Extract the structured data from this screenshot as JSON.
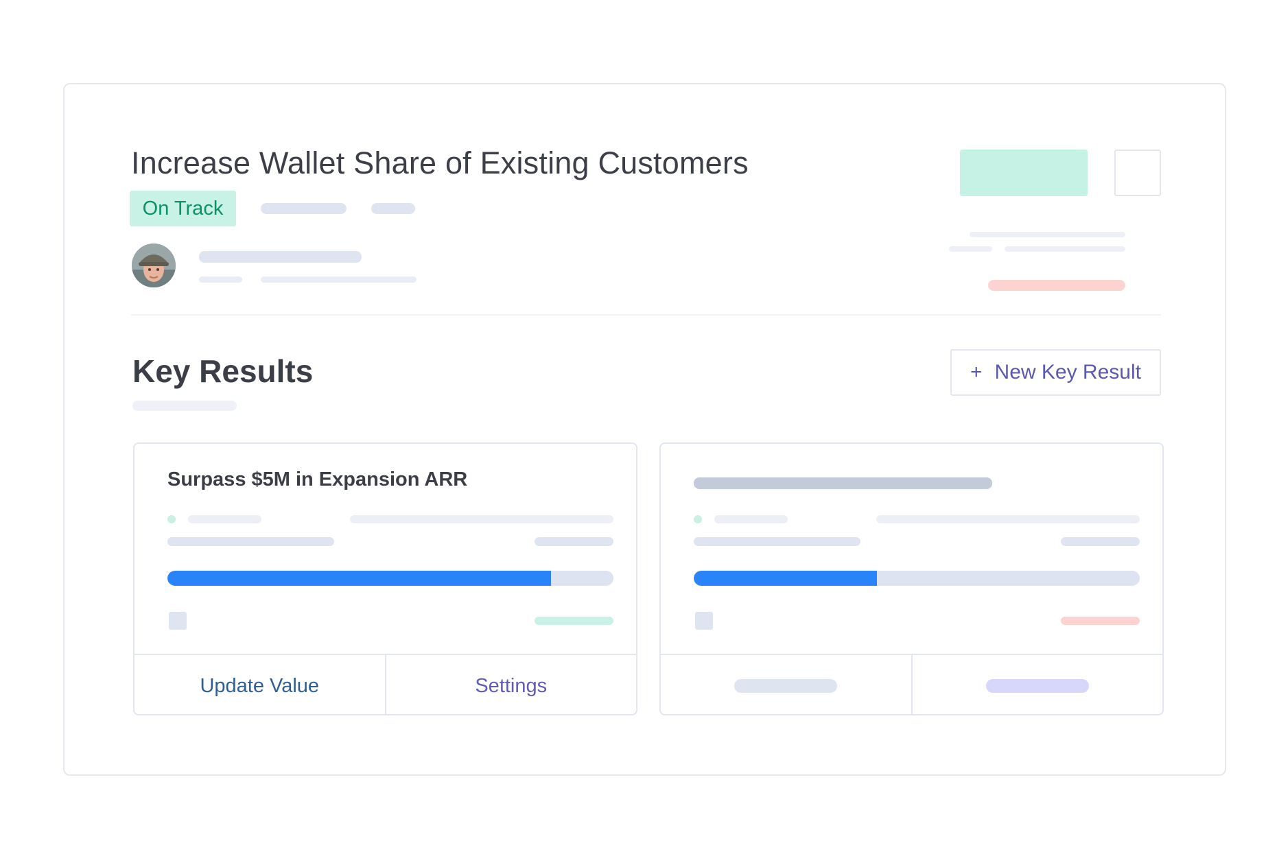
{
  "objective": {
    "title": "Increase Wallet Share of Existing Customers",
    "status": "On Track"
  },
  "key_results_section": {
    "title": "Key Results",
    "new_button_label": "New Key Result",
    "new_button_icon": "plus-icon"
  },
  "cards": [
    {
      "title": "Surpass $5M in Expansion ARR",
      "progress_fraction": 0.86,
      "actions": {
        "update_label": "Update Value",
        "settings_label": "Settings"
      }
    },
    {
      "title": "",
      "progress_fraction": 0.41,
      "actions": {
        "update_label": "",
        "settings_label": ""
      }
    }
  ],
  "colors": {
    "accent": "#2884f8",
    "status_green_text": "#109068",
    "status_green_bg": "#c8f2e5",
    "warning_red": "#fcd3d1",
    "link_purple": "#5a59b0",
    "link_blue": "#2f5e93"
  }
}
